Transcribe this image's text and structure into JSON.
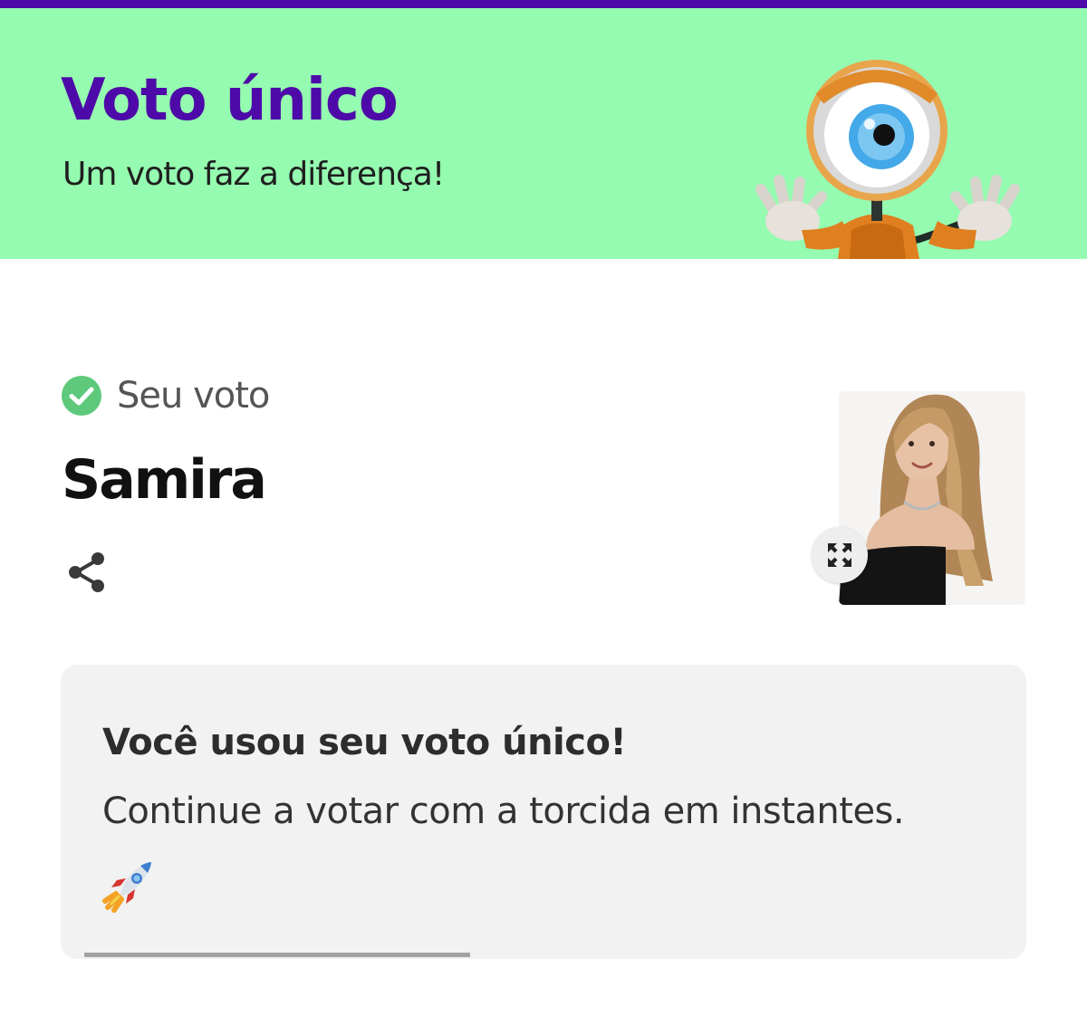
{
  "colors": {
    "top_bar": "#4d0aa8",
    "banner_bg": "#95fbb0",
    "title": "#4d0aa8",
    "check": "#5ec97b",
    "card_bg": "#f2f2f2",
    "progress": "#a3a3a3"
  },
  "banner": {
    "title": "Voto único",
    "subtitle": "Um voto faz a diferença!",
    "mascot_icon": "big-brother-eye-mascot"
  },
  "vote": {
    "status_icon": "check-circle-icon",
    "label": "Seu voto",
    "candidate": "Samira",
    "share_icon": "share-icon",
    "photo_icon": "candidate-photo",
    "expand_icon": "expand-icon"
  },
  "card": {
    "title": "Você usou seu voto único!",
    "text": "Continue a votar com a torcida em instantes.",
    "emoji_icon": "rocket-icon",
    "progress": 0.42
  }
}
